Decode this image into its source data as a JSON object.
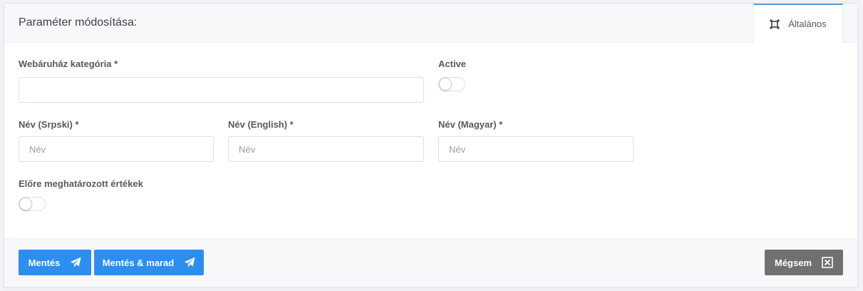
{
  "header": {
    "title": "Paraméter módosítása:",
    "tab_label": "Általános",
    "tab_icon": "frame-icon"
  },
  "form": {
    "category": {
      "label": "Webáruház kategória *",
      "value": "",
      "placeholder": ""
    },
    "active": {
      "label": "Active",
      "on": false
    },
    "name_sr": {
      "label": "Név (Srpski) *",
      "placeholder": "Név",
      "value": ""
    },
    "name_en": {
      "label": "Név (English) *",
      "placeholder": "Név",
      "value": ""
    },
    "name_hu": {
      "label": "Név (Magyar) *",
      "placeholder": "Név",
      "value": ""
    },
    "predefined": {
      "label": "Előre meghatározott értékek",
      "on": false
    }
  },
  "footer": {
    "save_label": "Mentés",
    "save_stay_label": "Mentés & marad",
    "cancel_label": "Mégsem",
    "save_icon": "paper-plane-icon",
    "cancel_icon": "close-box-icon"
  },
  "colors": {
    "primary": "#2d8ef0",
    "secondary": "#6f7072",
    "tab_accent": "#5b9bd5"
  }
}
